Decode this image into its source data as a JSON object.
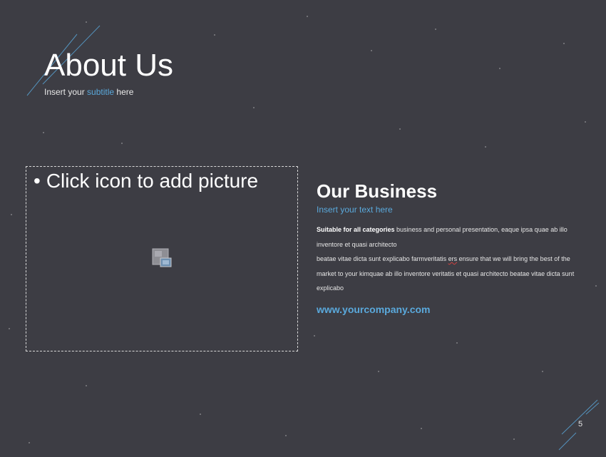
{
  "slide": {
    "title": "About Us",
    "subtitle_prefix": "Insert your ",
    "subtitle_highlight": "subtitle",
    "subtitle_suffix": " here",
    "page_number": "5"
  },
  "picture_placeholder": {
    "bullet": "•",
    "prompt": "Click icon to add picture",
    "icon": "insert-picture-icon"
  },
  "business": {
    "title": "Our Business",
    "subtitle": "Insert your text here",
    "lead_bold": "Suitable for all categories",
    "line1_rest": " business and personal presentation, eaque ipsa quae ab illo inventore et quasi architecto",
    "line2_start": "beatae vitae dicta sunt explicabo farmveritatis ",
    "line2_misspelled": "ers",
    "line2_end": " ensure that we will bring the best of the market to your kimquae ab illo inventore veritatis et quasi architecto beatae vitae dicta sunt explicabo",
    "website": "www.yourcompany.com"
  },
  "colors": {
    "background": "#3d3d44",
    "accent": "#5aa9dc",
    "text": "#ffffff"
  }
}
